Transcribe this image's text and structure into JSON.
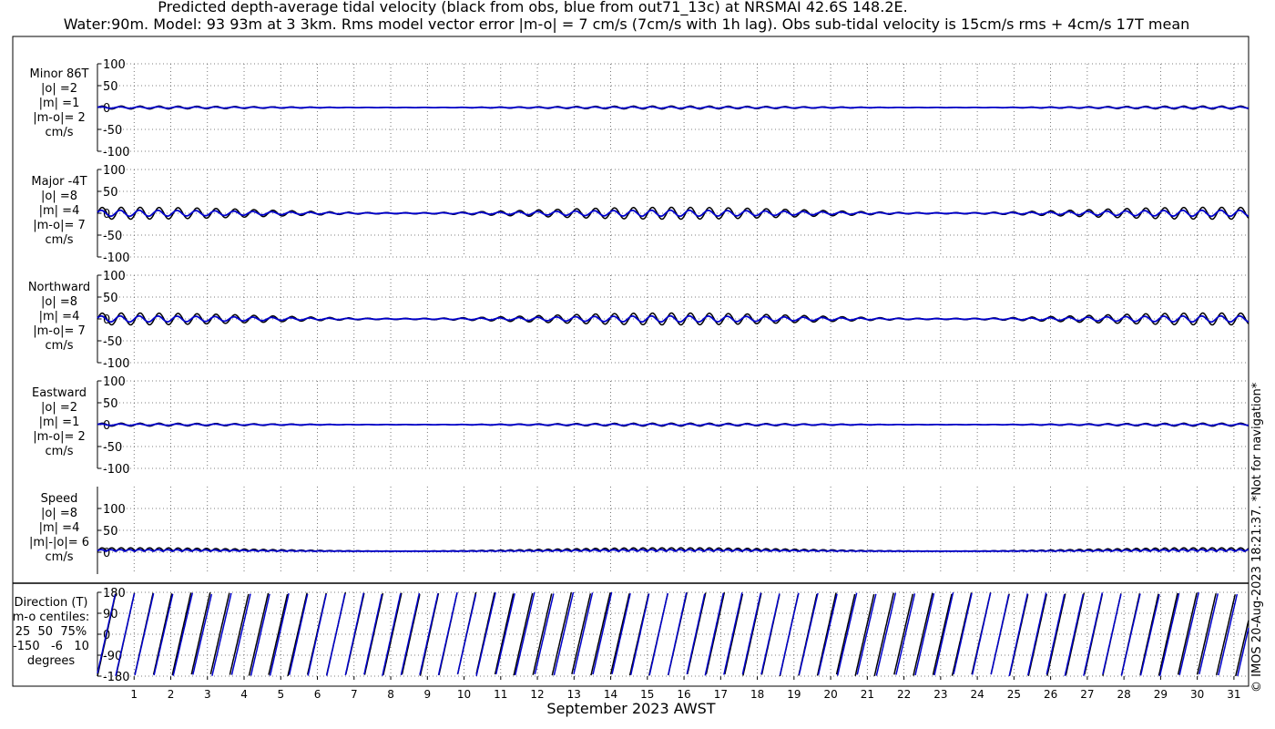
{
  "title": {
    "line1": "Predicted depth-average tidal velocity (black from obs, blue from out71_13c) at NRSMAI 42.6S 148.2E.",
    "line2": "Water:90m. Model: 93 93m at 3 3km. Rms model vector error |m-o| = 7 cm/s (7cm/s with 1h lag). Obs sub-tidal velocity is 15cm/s rms + 4cm/s 17T mean"
  },
  "xlabel": "September 2023 AWST",
  "credit": "© IMOS 20-Aug-2023 18:21:37. *Not for navigation*",
  "colors": {
    "obs": "#000000",
    "model": "#0000cc",
    "grid": "#555555"
  },
  "panels": [
    {
      "id": "minor",
      "label_lines": [
        "Minor 86T",
        "|o| =2",
        "|m| =1",
        "|m-o|= 2",
        "cm/s"
      ],
      "yticks": [
        "100",
        "50",
        "0",
        "-50",
        "-100"
      ]
    },
    {
      "id": "major",
      "label_lines": [
        "Major -4T",
        "|o| =8",
        "|m| =4",
        "|m-o|= 7",
        "cm/s"
      ],
      "yticks": [
        "100",
        "50",
        "0",
        "-50",
        "-100"
      ]
    },
    {
      "id": "northward",
      "label_lines": [
        "Northward",
        "|o| =8",
        "|m| =4",
        "|m-o|= 7",
        "cm/s"
      ],
      "yticks": [
        "100",
        "50",
        "0",
        "-50",
        "-100"
      ]
    },
    {
      "id": "eastward",
      "label_lines": [
        "Eastward",
        "|o| =2",
        "|m| =1",
        "|m-o|= 2",
        "cm/s"
      ],
      "yticks": [
        "100",
        "50",
        "0",
        "-50",
        "-100"
      ]
    },
    {
      "id": "speed",
      "label_lines": [
        "Speed",
        "|o| =8",
        "|m| =4",
        "|m|-|o|= 6",
        "cm/s"
      ],
      "yticks": [
        "100",
        "50",
        "0"
      ]
    },
    {
      "id": "direction",
      "label_lines": [
        "Direction (T)",
        "m-o centiles:",
        "25  50  75%",
        "-150   -6   10",
        "degrees"
      ],
      "yticks": [
        "180",
        "90",
        "0",
        "-90",
        "-180"
      ]
    }
  ],
  "chart_data": {
    "type": "line",
    "x_domain": [
      0.0,
      31.4
    ],
    "x_unit": "day of September 2023 (AWST)",
    "x_ticks": [
      1,
      2,
      3,
      4,
      5,
      6,
      7,
      8,
      9,
      10,
      11,
      12,
      13,
      14,
      15,
      16,
      17,
      18,
      19,
      20,
      21,
      22,
      23,
      24,
      25,
      26,
      27,
      28,
      29,
      30,
      31
    ],
    "panels": [
      {
        "id": "minor",
        "ylim": [
          -100,
          100
        ],
        "obs_amplitude": 2,
        "model_amplitude": 1
      },
      {
        "id": "major",
        "ylim": [
          -100,
          100
        ],
        "obs_amplitude": 8,
        "model_amplitude": 4
      },
      {
        "id": "northward",
        "ylim": [
          -100,
          100
        ],
        "obs_amplitude": 8,
        "model_amplitude": 4
      },
      {
        "id": "eastward",
        "ylim": [
          -100,
          100
        ],
        "obs_amplitude": 2,
        "model_amplitude": 1
      },
      {
        "id": "speed",
        "ylim": [
          0,
          100
        ],
        "obs_amplitude": 8,
        "model_amplitude": 4
      },
      {
        "id": "direction",
        "ylim": [
          -180,
          180
        ]
      }
    ],
    "series": [
      {
        "name": "obs",
        "color": "#000000"
      },
      {
        "name": "out71_13c",
        "color": "#0000cc"
      }
    ]
  }
}
